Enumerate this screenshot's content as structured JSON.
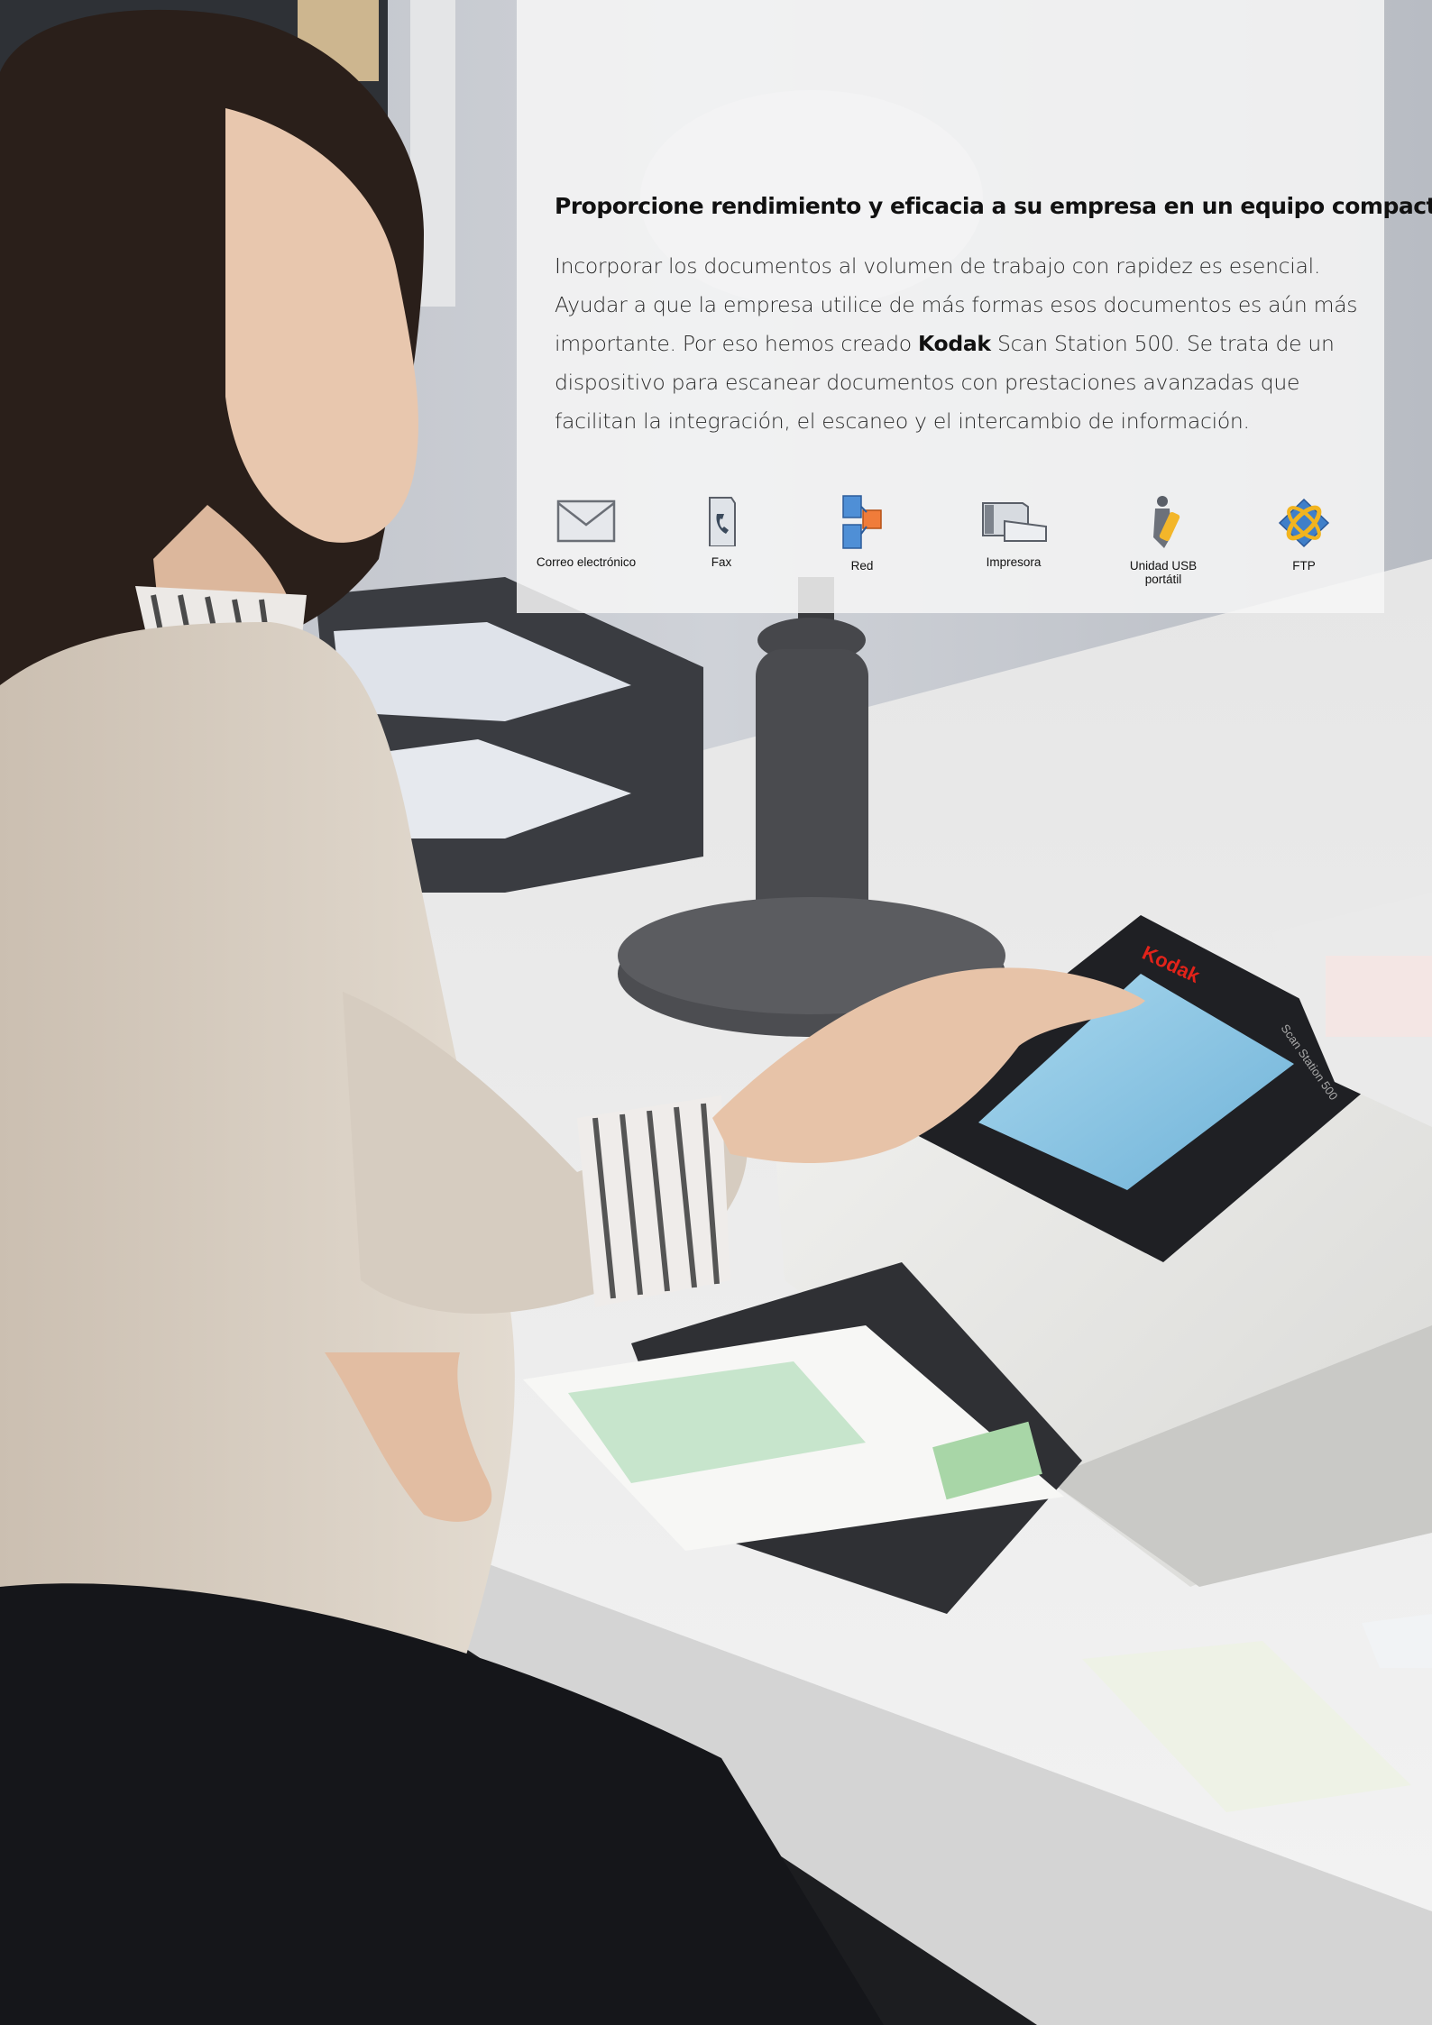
{
  "panel": {
    "headline": "Proporcione rendimiento y eficacia a su empresa en un equipo compacto.",
    "body_part1": "Incorporar los documentos al volumen de trabajo con rapidez es esencial. Ayudar a que la empresa utilice de más formas esos documentos es aún más importante. Por eso hemos creado ",
    "body_brand": "Kodak",
    "body_part2": " Scan Station 500. Se trata de un dispositivo para escanear documentos con prestaciones avanzadas que facilitan la integración, el escaneo y el intercambio de información."
  },
  "destinations": [
    {
      "label": "Correo electrónico",
      "icon": "envelope-icon"
    },
    {
      "label": "Fax",
      "icon": "fax-icon"
    },
    {
      "label": "Red",
      "icon": "network-icon"
    },
    {
      "label": "Impresora",
      "icon": "printer-icon"
    },
    {
      "label": "Unidad USB portátil",
      "icon": "usb-drive-icon"
    },
    {
      "label": "FTP",
      "icon": "ftp-icon"
    }
  ],
  "device": {
    "brand": "Kodak",
    "model": "Scan Station 500"
  },
  "colors": {
    "panel_bg": "#f6f6f6",
    "wall": "#c3c6cc",
    "desk": "#e9e9e9",
    "kodak_red": "#e2231a",
    "screen_blue": "#8ec9e6",
    "sweater": "#d8cfc4"
  }
}
